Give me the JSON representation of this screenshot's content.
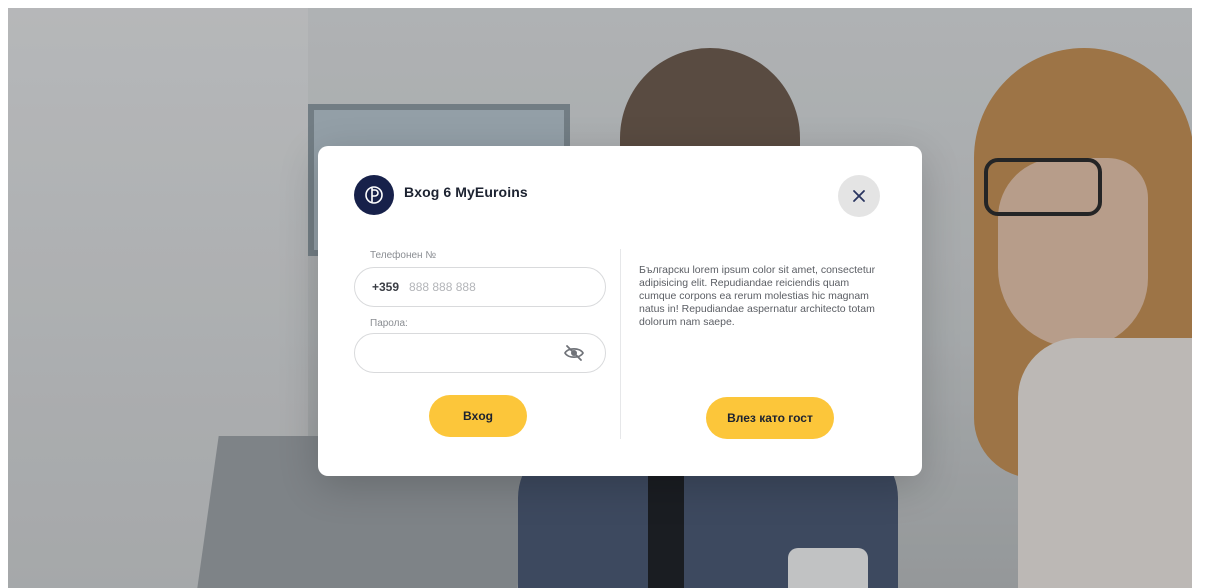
{
  "modal": {
    "title": "Bxog 6 MyEuroins",
    "close_icon": "close-icon",
    "logo_icon": "euroins-logo-icon"
  },
  "login_form": {
    "phone_label": "Телефонен №",
    "phone_prefix": "+359",
    "phone_placeholder": "888 888 888",
    "password_label": "Парола:",
    "password_value": "",
    "password_toggle_icon": "eye-off-icon",
    "login_button_label": "Bxog"
  },
  "guest_panel": {
    "description": "Българскu lorem ipsum color sit amet, consectetur adipisicing elit. Repudiandae reiciendis quam cumque corpons ea rerum molestias hic magnam natus in! Repudiandae aspernatur architecto totam dolorum nam saepe.",
    "guest_button_label": "Влез като гост"
  },
  "colors": {
    "accent": "#fcc63a",
    "brand": "#17214a",
    "close_bg": "#e4e4e4"
  }
}
